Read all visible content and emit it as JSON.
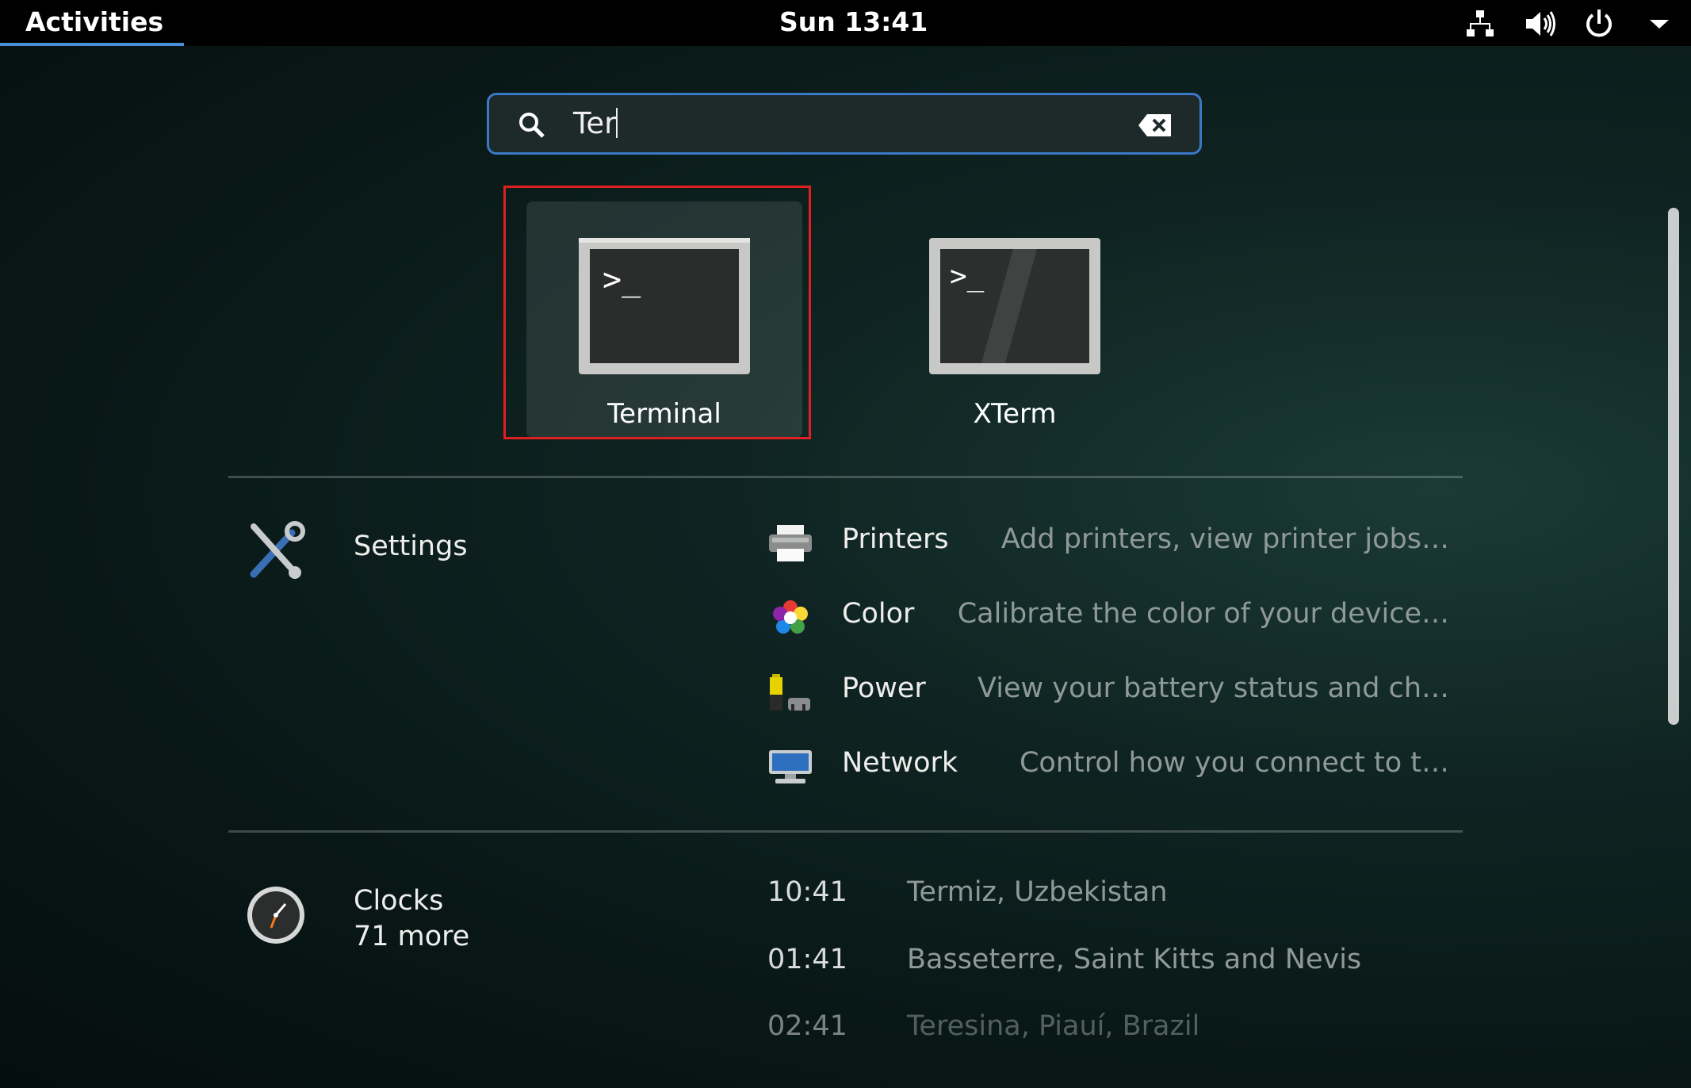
{
  "topbar": {
    "activities_label": "Activities",
    "clock": "Sun 13:41"
  },
  "tray_icons": [
    "network-icon",
    "volume-icon",
    "power-icon",
    "menu-arrow-icon"
  ],
  "search": {
    "value": "Ter",
    "search_icon": "search-icon",
    "clear_icon": "clear-icon"
  },
  "apps": [
    {
      "label": "Terminal",
      "icon": "terminal-icon",
      "selected": true
    },
    {
      "label": "XTerm",
      "icon": "xterm-icon",
      "selected": false
    }
  ],
  "settings": {
    "provider_label": "Settings",
    "items": [
      {
        "name": "Printers",
        "desc": "Add printers, view printer jobs…",
        "icon": "printer-icon"
      },
      {
        "name": "Color",
        "desc": "Calibrate the color of your device…",
        "icon": "color-icon"
      },
      {
        "name": "Power",
        "desc": "View your battery status and ch…",
        "icon": "power-battery-icon"
      },
      {
        "name": "Network",
        "desc": "Control how you connect to t…",
        "icon": "network-settings-icon"
      }
    ]
  },
  "clocks": {
    "provider_label": "Clocks",
    "more_label": "71 more",
    "items": [
      {
        "time": "10:41",
        "location": "Termiz, Uzbekistan"
      },
      {
        "time": "01:41",
        "location": "Basseterre, Saint Kitts and Nevis"
      },
      {
        "time": "02:41",
        "location": "Teresina, Piauí, Brazil"
      }
    ]
  }
}
